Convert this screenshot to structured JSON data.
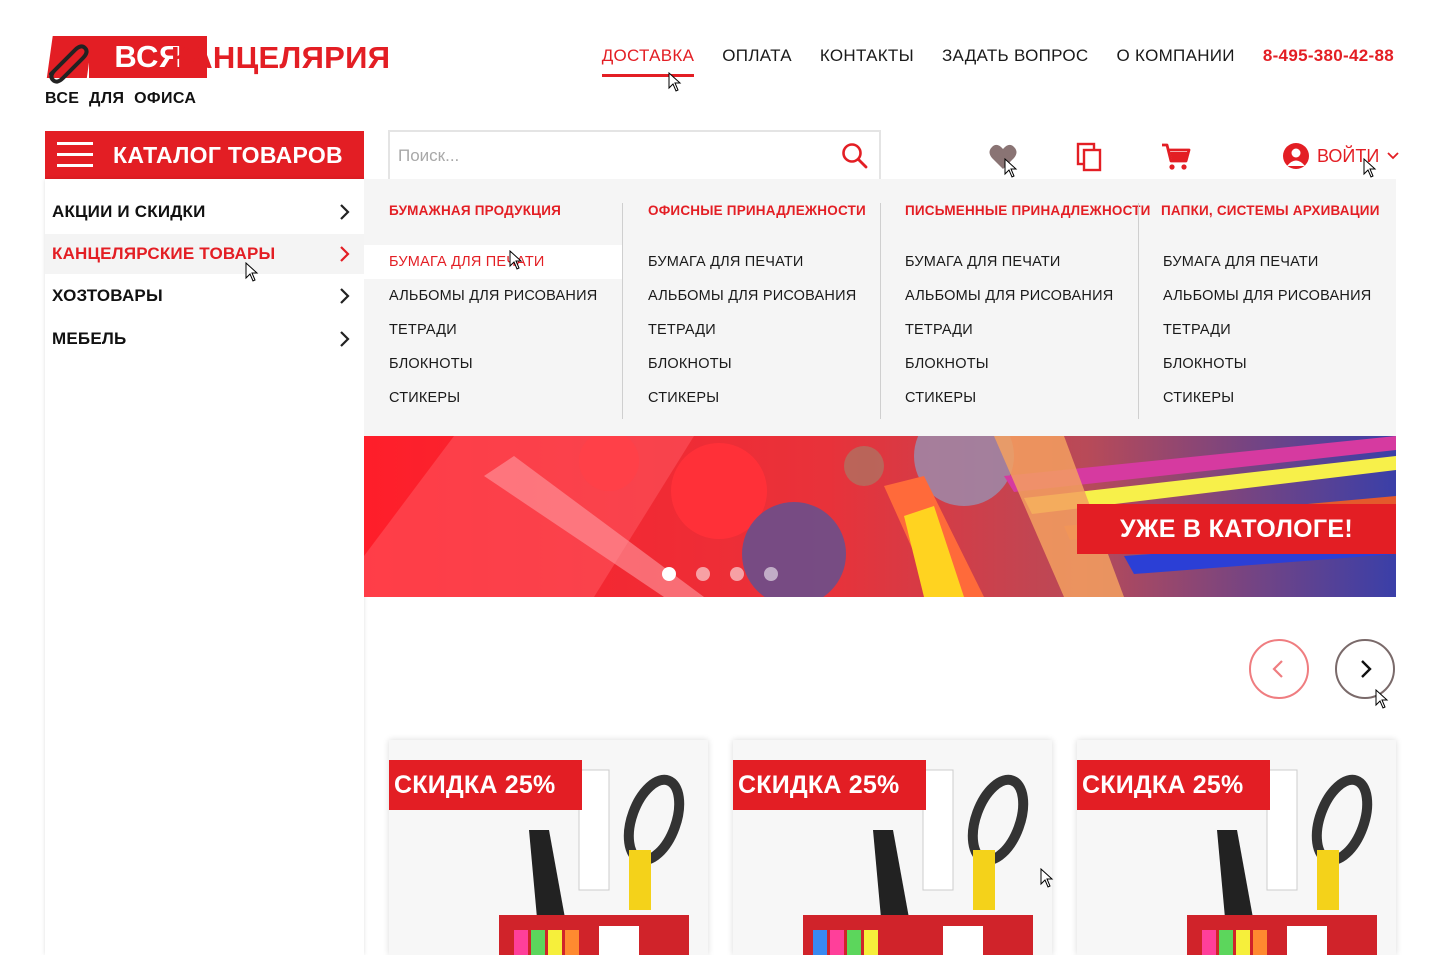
{
  "logo": {
    "box_text": "ВСЯ",
    "word_text": "КАНЦЕЛЯРИЯ",
    "tagline": "ВСЕ  ДЛЯ  ОФИСА"
  },
  "nav": {
    "items": [
      "ДОСТАВКА",
      "ОПЛАТА",
      "КОНТАКТЫ",
      "ЗАДАТЬ ВОПРОС",
      "О КОМПАНИИ"
    ],
    "phone": "8-495-380-42-88",
    "active_index": 0
  },
  "catalog_button": {
    "label": "КАТАЛОГ ТОВАРОВ"
  },
  "search": {
    "placeholder": "Поиск...",
    "value": ""
  },
  "header_icons": [
    "heart-icon",
    "compare-icon",
    "cart-icon"
  ],
  "login": {
    "label": "ВОЙТИ"
  },
  "sidebar": {
    "items": [
      {
        "label": "АКЦИИ И СКИДКИ",
        "active": false
      },
      {
        "label": "КАНЦЕЛЯРСКИЕ ТОВАРЫ",
        "active": true
      },
      {
        "label": "ХОЗТОВАРЫ",
        "active": false
      },
      {
        "label": "МЕБЕЛЬ",
        "active": false
      }
    ]
  },
  "mega_menu": {
    "columns": [
      {
        "title": "БУМАЖНАЯ ПРОДУКЦИЯ",
        "items": [
          "БУМАГА ДЛЯ ПЕЧАТИ",
          "АЛЬБОМЫ ДЛЯ РИСОВАНИЯ",
          "ТЕТРАДИ",
          "БЛОКНОТЫ",
          "СТИКЕРЫ"
        ]
      },
      {
        "title": "ОФИСНЫЕ ПРИНАДЛЕЖНОСТИ",
        "items": [
          "БУМАГА ДЛЯ ПЕЧАТИ",
          "АЛЬБОМЫ ДЛЯ РИСОВАНИЯ",
          "ТЕТРАДИ",
          "БЛОКНОТЫ",
          "СТИКЕРЫ"
        ]
      },
      {
        "title": "ПИСЬМЕННЫЕ ПРИНАДЛЕЖНОСТИ",
        "items": [
          "БУМАГА ДЛЯ ПЕЧАТИ",
          "АЛЬБОМЫ ДЛЯ РИСОВАНИЯ",
          "ТЕТРАДИ",
          "БЛОКНОТЫ",
          "СТИКЕРЫ"
        ]
      },
      {
        "title": "ПАПКИ, СИСТЕМЫ АРХИВАЦИИ",
        "items": [
          "БУМАГА ДЛЯ ПЕЧАТИ",
          "АЛЬБОМЫ ДЛЯ РИСОВАНИЯ",
          "ТЕТРАДИ",
          "БЛОКНОТЫ",
          "СТИКЕРЫ"
        ]
      }
    ],
    "highlighted": {
      "column": 0,
      "item": 0
    }
  },
  "banner": {
    "tag": "УЖЕ В КАТОЛОГЕ!",
    "slides": 4,
    "active_slide": 0
  },
  "products": [
    {
      "badge": "СКИДКА 25%"
    },
    {
      "badge": "СКИДКА 25%"
    },
    {
      "badge": "СКИДКА 25%"
    }
  ],
  "colors": {
    "brand": "#e31e24",
    "menu_bg": "#f5f5f5",
    "text": "#1a1a1a"
  }
}
